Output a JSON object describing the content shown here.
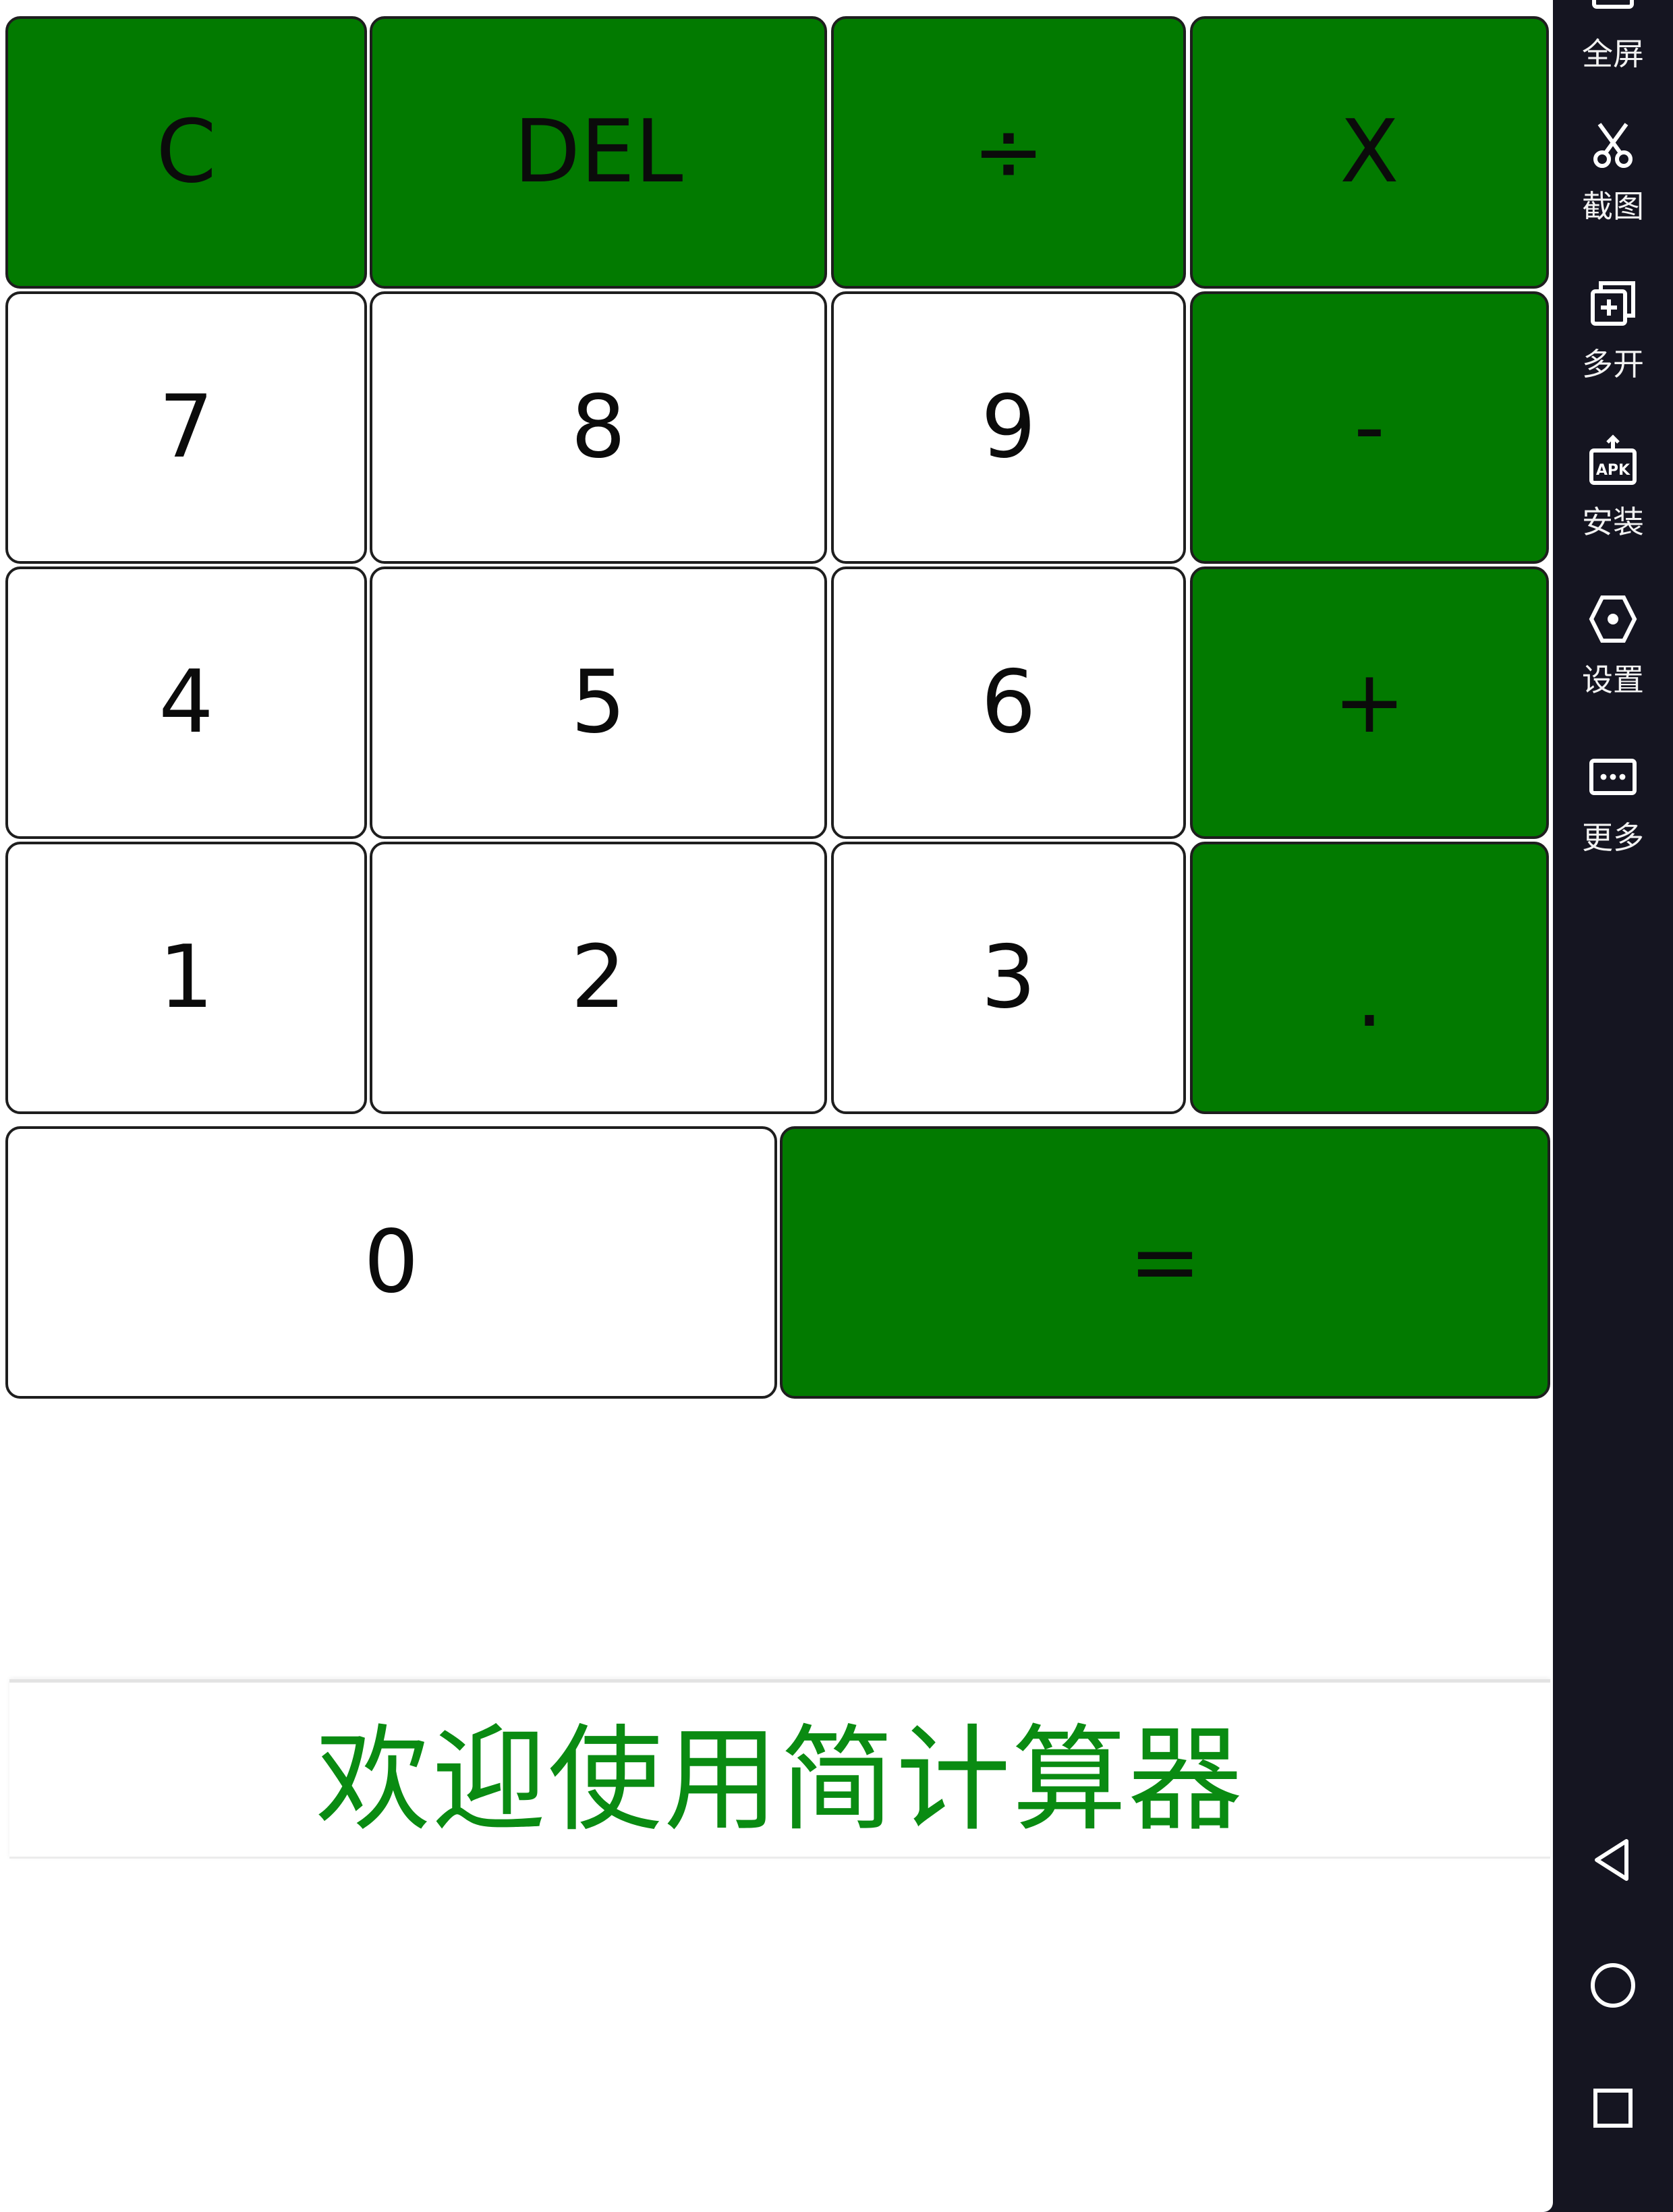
{
  "calculator": {
    "keys": {
      "clear": "C",
      "delete": "DEL",
      "divide": "÷",
      "multiply": "X",
      "seven": "7",
      "eight": "8",
      "nine": "9",
      "minus": "-",
      "four": "4",
      "five": "5",
      "six": "6",
      "plus": "+",
      "one": "1",
      "two": "2",
      "three": "3",
      "dot": ".",
      "zero": "0",
      "equals": "="
    },
    "banner_text": "欢迎使用简计算器"
  },
  "sidebar": {
    "fullscreen": "全屏",
    "screenshot": "截图",
    "multi_open": "多开",
    "install": "安装",
    "settings": "设置",
    "more": "更多"
  },
  "colors": {
    "accent_green": "#027a00",
    "banner_text_green": "#0a8b12",
    "sidebar_bg": "#151521"
  }
}
